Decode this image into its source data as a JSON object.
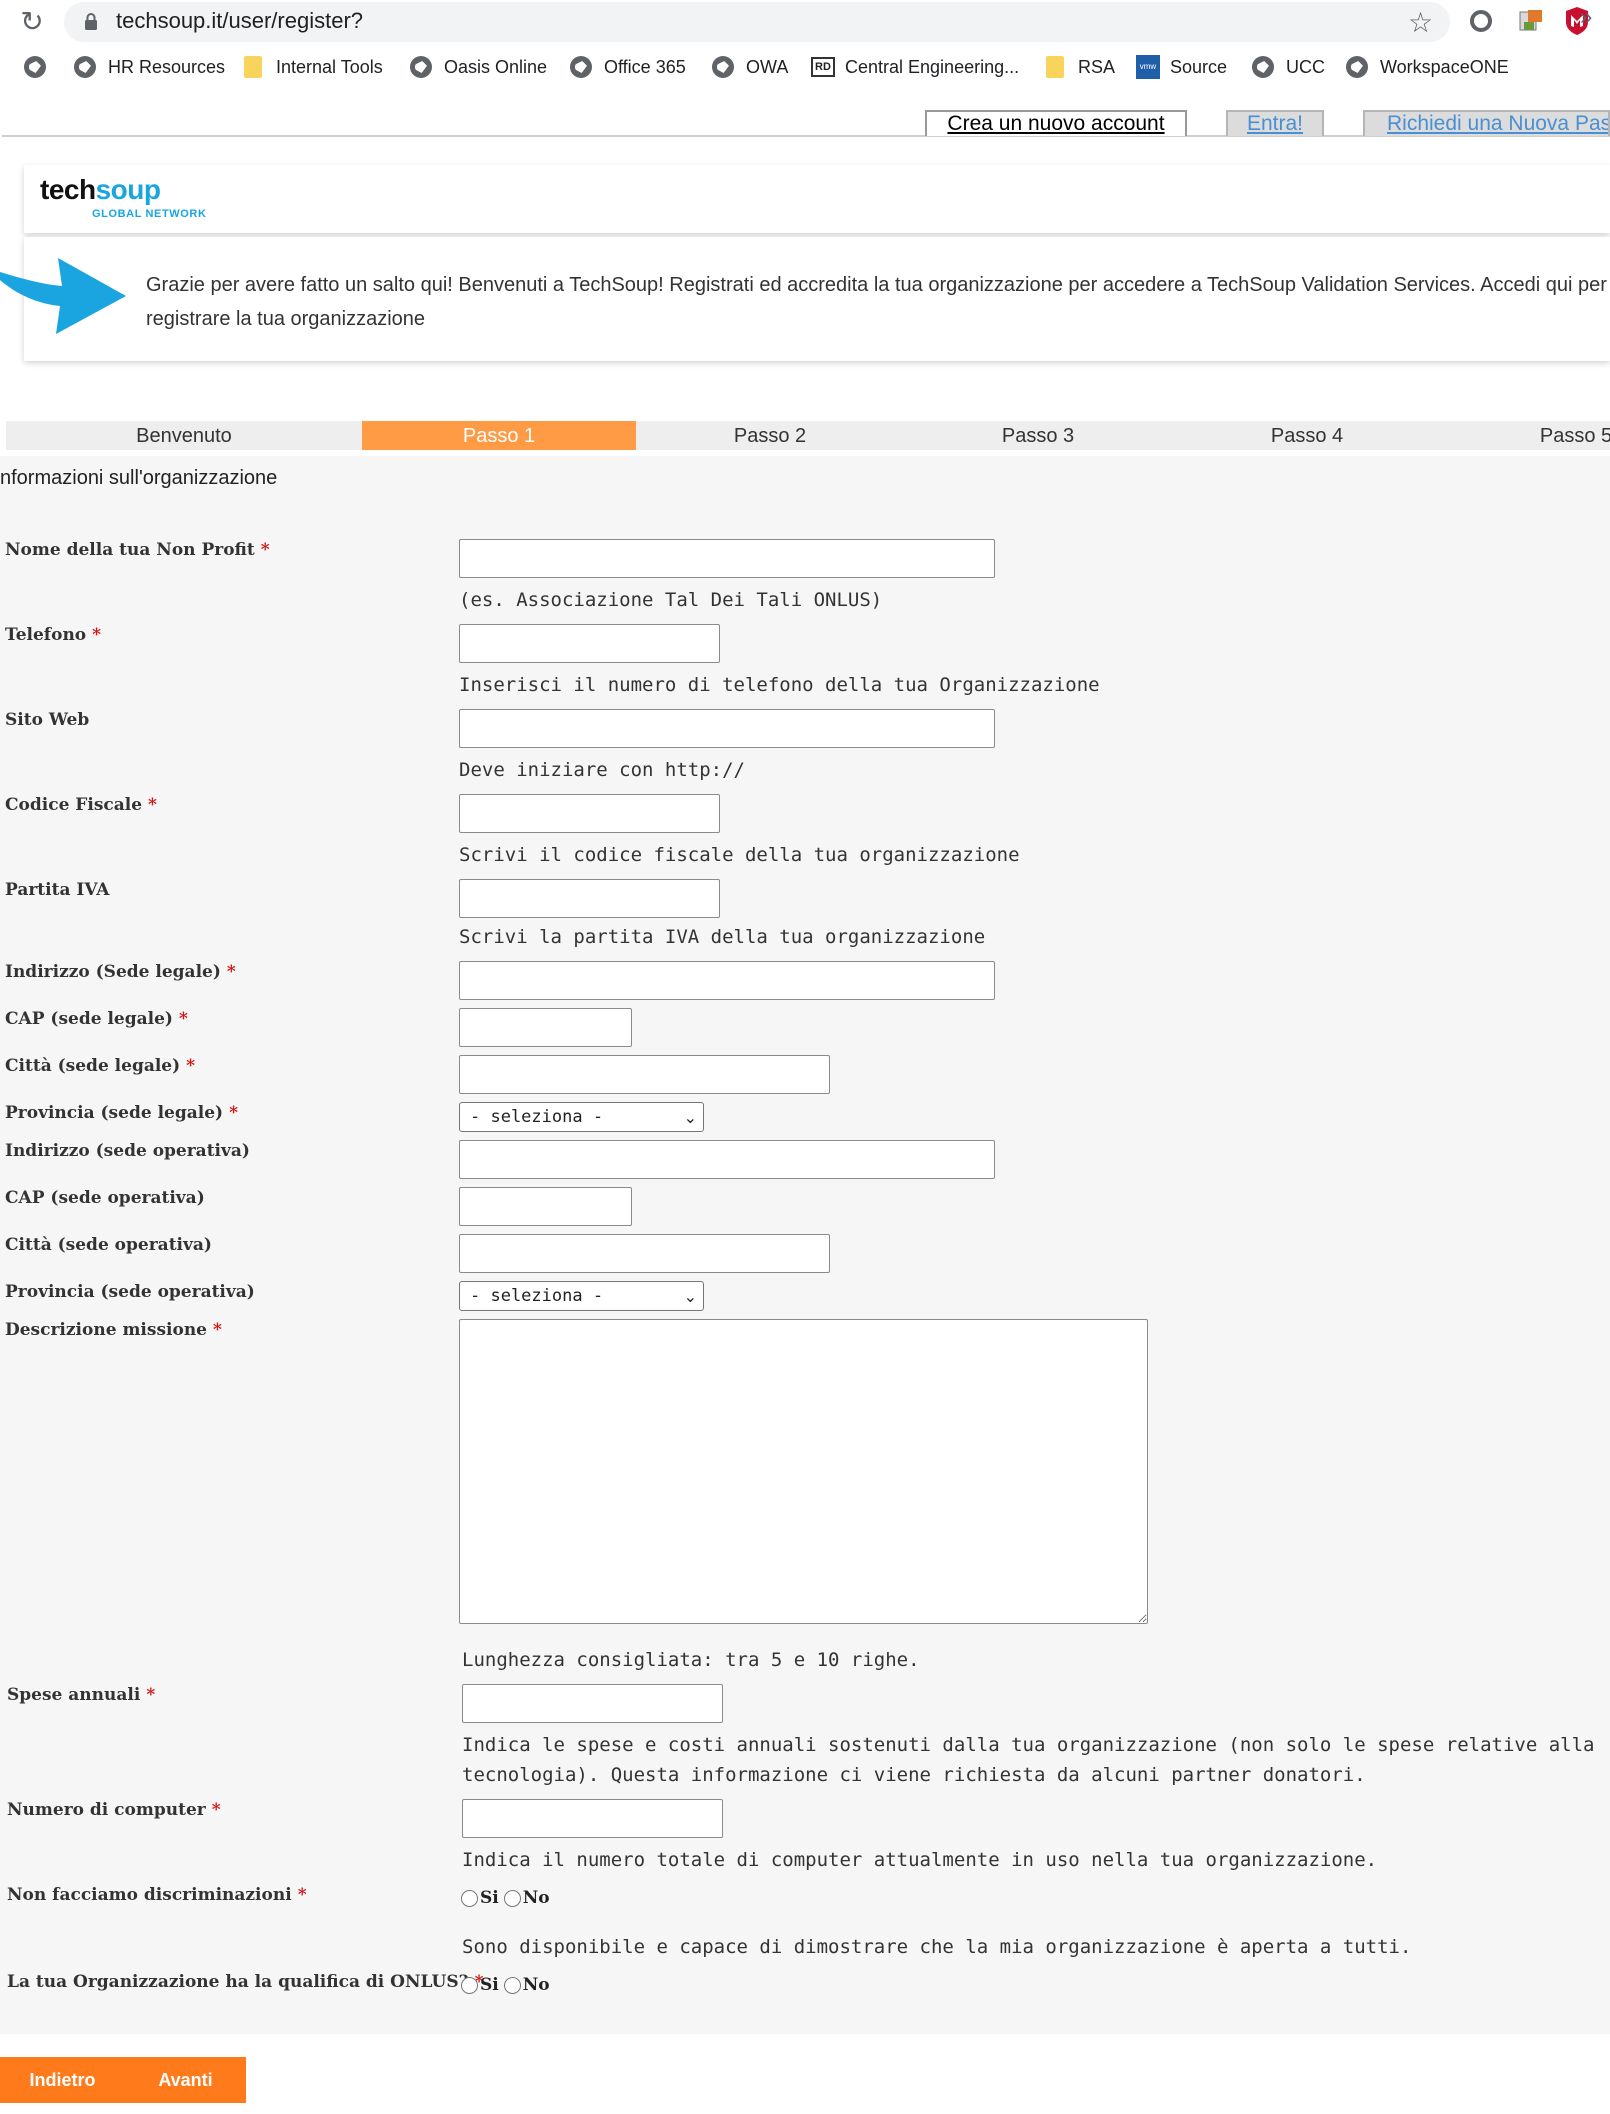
{
  "browser": {
    "url_text": "techsoup.it/user/register?",
    "bookmarks": [
      {
        "label": "HR Resources",
        "icon": "globe-icon"
      },
      {
        "label": "Internal Tools",
        "icon": "folder-icon"
      },
      {
        "label": "Oasis Online",
        "icon": "globe-icon"
      },
      {
        "label": "Office 365",
        "icon": "globe-icon"
      },
      {
        "label": "OWA",
        "icon": "globe-icon"
      },
      {
        "label": "Central Engineering...",
        "icon": "rd-icon"
      },
      {
        "label": "RSA",
        "icon": "folder-icon"
      },
      {
        "label": "Source",
        "icon": "vmw-icon"
      },
      {
        "label": "UCC",
        "icon": "globe-icon"
      },
      {
        "label": "WorkspaceONE",
        "icon": "globe-icon"
      }
    ],
    "more_label": "»",
    "vmw_label": "vmw",
    "rd_label": "RD"
  },
  "top_links": {
    "crea": "Crea un nuovo account",
    "entra": "Entra!",
    "richiedi": "Richiedi una Nuova Pas"
  },
  "logo": {
    "tech": "tech",
    "soup": "soup",
    "sub": "GLOBAL NETWORK"
  },
  "welcome": {
    "text": "Grazie per avere fatto un salto qui! Benvenuti a TechSoup! Registrati ed accredita la tua organizzazione per accedere a TechSoup Validation Services. Accedi qui per registrare la tua organizzazione"
  },
  "steps": [
    "Benvenuto",
    "Passo 1",
    "Passo 2",
    "Passo 3",
    "Passo 4",
    "Passo 5"
  ],
  "active_step": "Passo 1",
  "form": {
    "section_title": "nformazioni sull'organizzazione",
    "required_mark": "*",
    "fields": {
      "nome": {
        "label": "Nome della tua Non Profit",
        "hint": "(es. Associazione Tal Dei Tali ONLUS)",
        "value": ""
      },
      "telefono": {
        "label": "Telefono",
        "hint": "Inserisci il numero di telefono della tua Organizzazione",
        "value": ""
      },
      "sito": {
        "label": "Sito Web",
        "hint": "Deve iniziare con http://",
        "value": ""
      },
      "codice": {
        "label": "Codice Fiscale",
        "hint": "Scrivi il codice fiscale della tua organizzazione",
        "value": ""
      },
      "iva": {
        "label": "Partita IVA",
        "hint": "Scrivi la partita IVA della tua organizzazione",
        "value": ""
      },
      "indirizzo_legale": {
        "label": "Indirizzo (Sede legale)",
        "value": ""
      },
      "cap_legale": {
        "label": "CAP (sede legale)",
        "value": ""
      },
      "citta_legale": {
        "label": "Città (sede legale)",
        "value": ""
      },
      "provincia_legale": {
        "label": "Provincia (sede legale)",
        "selected": "- seleziona -"
      },
      "indirizzo_operativa": {
        "label": "Indirizzo (sede operativa)",
        "value": ""
      },
      "cap_operativa": {
        "label": "CAP (sede operativa)",
        "value": ""
      },
      "citta_operativa": {
        "label": "Città (sede operativa)",
        "value": ""
      },
      "provincia_operativa": {
        "label": "Provincia (sede operativa)",
        "selected": "- seleziona -"
      },
      "missione": {
        "label": "Descrizione missione",
        "hint": "Lunghezza consigliata: tra 5 e 10 righe.",
        "value": ""
      },
      "spese": {
        "label": "Spese annuali",
        "hint": "Indica le spese e costi annuali sostenuti dalla tua organizzazione (non solo le spese relative alla tecnologia). Questa informazione ci viene richiesta da alcuni partner donatori.",
        "value": ""
      },
      "computer": {
        "label": "Numero di computer",
        "hint": "Indica il numero totale di computer attualmente in uso nella tua organizzazione.",
        "value": ""
      },
      "discriminazioni": {
        "label": "Non facciamo discriminazioni",
        "hint": "Sono disponibile e capace di dimostrare che la mia organizzazione è aperta a tutti.",
        "opt_si": "Si",
        "opt_no": "No"
      },
      "onlus": {
        "label": "La tua Organizzazione ha la qualifica di ONLUS?",
        "opt_si": "Si",
        "opt_no": "No"
      }
    }
  },
  "buttons": {
    "back": "Indietro",
    "next": "Avanti"
  },
  "colors": {
    "accent_orange": "#ff9a45",
    "button_orange": "#ff7a1a",
    "brand_blue": "#1aa5e1",
    "required_red": "#d21414",
    "link_blue": "#4a8fd1"
  }
}
